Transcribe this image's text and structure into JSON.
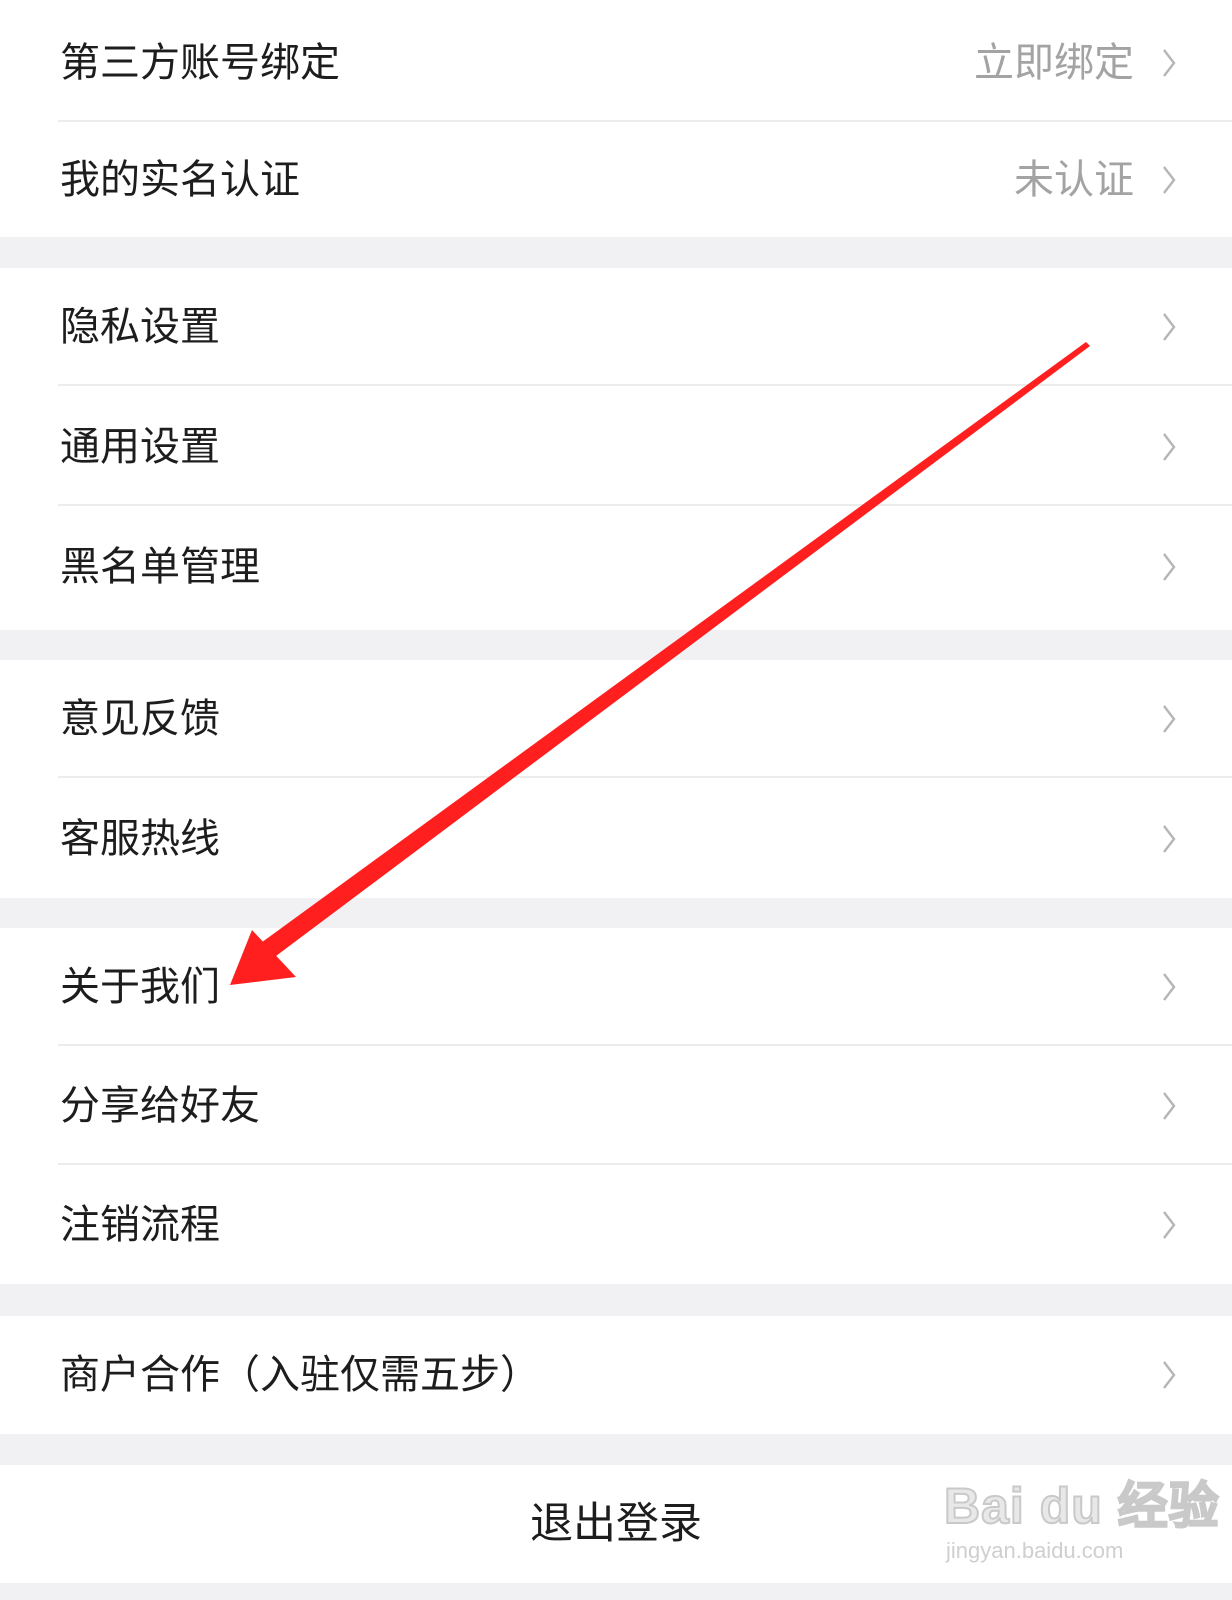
{
  "groups": [
    {
      "items": [
        {
          "label": "第三方账号绑定",
          "value": "立即绑定"
        },
        {
          "label": "我的实名认证",
          "value": "未认证"
        }
      ]
    },
    {
      "items": [
        {
          "label": "隐私设置"
        },
        {
          "label": "通用设置"
        },
        {
          "label": "黑名单管理"
        }
      ]
    },
    {
      "items": [
        {
          "label": "意见反馈"
        },
        {
          "label": "客服热线"
        }
      ]
    },
    {
      "items": [
        {
          "label": "关于我们"
        },
        {
          "label": "分享给好友"
        },
        {
          "label": "注销流程"
        }
      ]
    },
    {
      "items": [
        {
          "label": "商户合作（入驻仅需五步）"
        }
      ]
    }
  ],
  "logout": {
    "label": "退出登录"
  },
  "annotation": {
    "type": "arrow",
    "color": "#ff1f1f",
    "points_to": "关于我们"
  },
  "watermark": {
    "brand": "Bai du 经验",
    "url": "jingyan.baidu.com"
  },
  "colors": {
    "background": "#f1f1f3",
    "row_background": "#ffffff",
    "label_text": "#1d1d1d",
    "value_text": "#a3a3a3",
    "chevron": "#b5b5b5"
  }
}
